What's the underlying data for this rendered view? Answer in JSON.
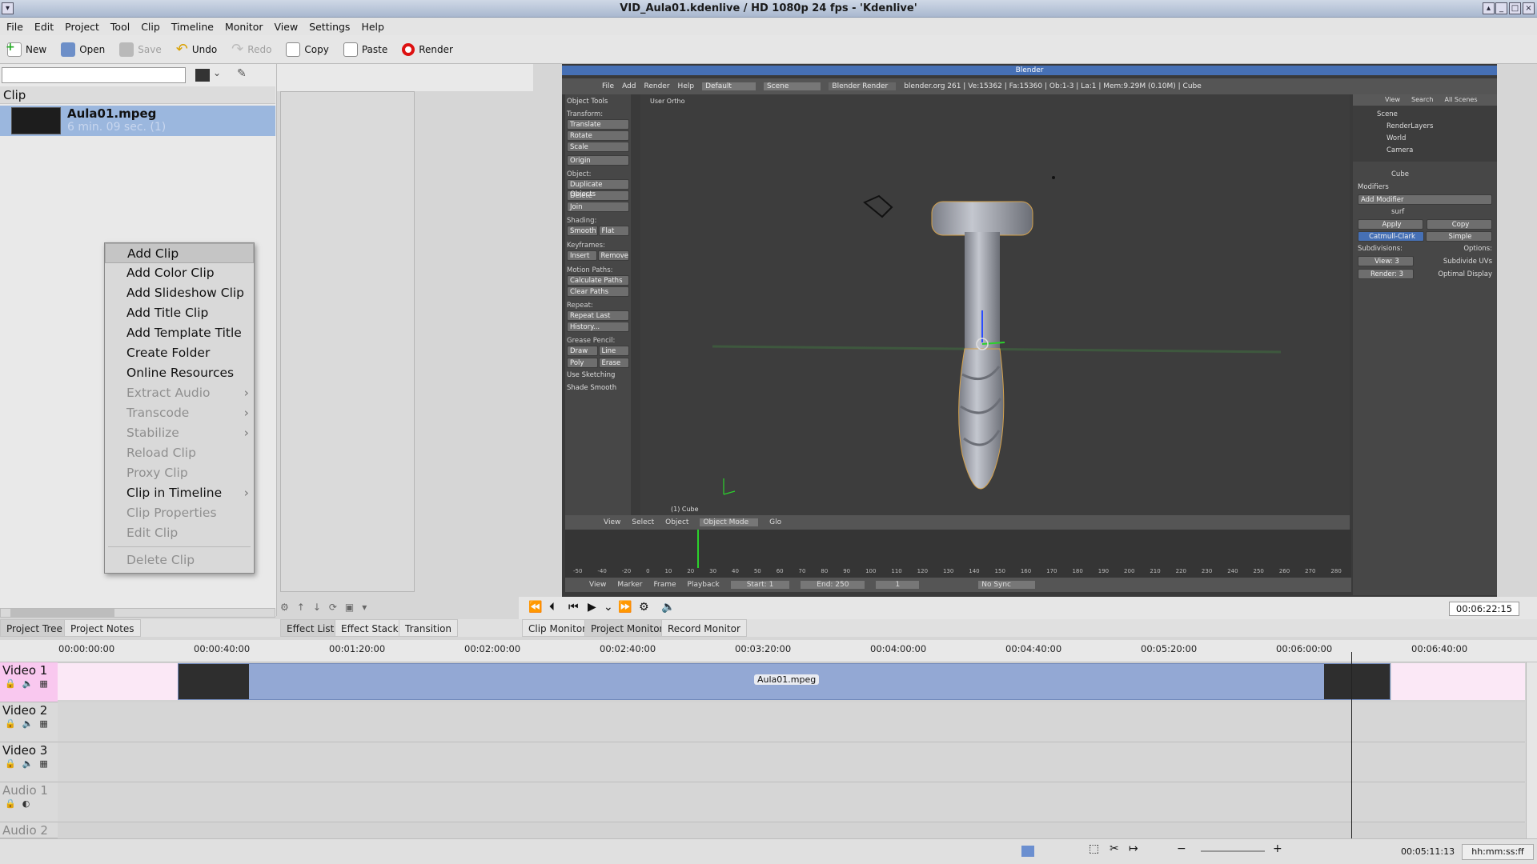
{
  "window": {
    "title": "VID_Aula01.kdenlive / HD 1080p 24 fps - 'Kdenlive'"
  },
  "menu": [
    "File",
    "Edit",
    "Project",
    "Tool",
    "Clip",
    "Timeline",
    "Monitor",
    "View",
    "Settings",
    "Help"
  ],
  "toolbar": {
    "new": "New",
    "open": "Open",
    "save": "Save",
    "undo": "Undo",
    "redo": "Redo",
    "copy": "Copy",
    "paste": "Paste",
    "render": "Render"
  },
  "bin": {
    "header": "Clip",
    "clip_name": "Aula01.mpeg",
    "clip_duration": "6 min. 09 sec. (1)"
  },
  "context_menu": {
    "items": [
      {
        "label": "Add Clip"
      },
      {
        "label": "Add Color Clip"
      },
      {
        "label": "Add Slideshow Clip"
      },
      {
        "label": "Add Title Clip"
      },
      {
        "label": "Add Template Title"
      },
      {
        "label": "Create Folder"
      },
      {
        "label": "Online Resources"
      },
      {
        "label": "Extract Audio"
      },
      {
        "label": "Transcode"
      },
      {
        "label": "Stabilize"
      },
      {
        "label": "Reload Clip"
      },
      {
        "label": "Proxy Clip"
      },
      {
        "label": "Clip in Timeline"
      },
      {
        "label": "Clip Properties"
      },
      {
        "label": "Edit Clip"
      },
      {
        "label": "Delete Clip"
      }
    ]
  },
  "blender": {
    "title": "Blender",
    "menu": [
      "File",
      "Add",
      "Render",
      "Help"
    ],
    "layout": "Default",
    "scene": "Scene",
    "engine": "Blender Render",
    "stats": "blender.org 261 | Ve:15362 | Fa:15360 | Ob:1-3 | La:1 | Mem:9.29M (0.10M) | Cube",
    "view_label": "User Ortho",
    "object_label": "(1) Cube",
    "tools": {
      "header": "Object Tools",
      "transform": "Transform:",
      "translate": "Translate",
      "rotate": "Rotate",
      "scale": "Scale",
      "origin": "Origin",
      "object": "Object:",
      "duplicate": "Duplicate Objects",
      "delete": "Delete",
      "join": "Join",
      "shading": "Shading:",
      "smooth": "Smooth",
      "flat": "Flat",
      "keyframes": "Keyframes:",
      "insert": "Insert",
      "remove": "Remove",
      "motion": "Motion Paths:",
      "calc": "Calculate Paths",
      "clear": "Clear Paths",
      "repeat": "Repeat:",
      "repeat_last": "Repeat Last",
      "history": "History...",
      "grease": "Grease Pencil:",
      "draw": "Draw",
      "line": "Line",
      "poly": "Poly",
      "erase": "Erase",
      "use_sketching": "Use Sketching",
      "shade_smooth": "Shade Smooth"
    },
    "outliner": {
      "view": "View",
      "search": "Search",
      "all_scenes": "All Scenes",
      "scene": "Scene",
      "render_layers": "RenderLayers",
      "world": "World",
      "camera": "Camera"
    },
    "properties": {
      "object": "Cube",
      "modifiers": "Modifiers",
      "add_modifier": "Add Modifier",
      "mod_name": "surf",
      "apply": "Apply",
      "copy": "Copy",
      "catmull": "Catmull-Clark",
      "simple": "Simple",
      "subdivisions": "Subdivisions:",
      "options": "Options:",
      "view": "View: 3",
      "render": "Render: 3",
      "subdiv_uvs": "Subdivide UVs",
      "optimal": "Optimal Display"
    },
    "footer3d": {
      "view": "View",
      "select": "Select",
      "object": "Object",
      "mode": "Object Mode",
      "glo": "Glo"
    },
    "timeline_footer": {
      "view": "View",
      "marker": "Marker",
      "frame": "Frame",
      "playback": "Playback",
      "start": "Start: 1",
      "end": "End: 250",
      "current": "1",
      "sync": "No Sync"
    },
    "ticks": [
      "-50",
      "-40",
      "-20",
      "0",
      "10",
      "20",
      "30",
      "40",
      "50",
      "60",
      "70",
      "80",
      "90",
      "100",
      "110",
      "120",
      "130",
      "140",
      "150",
      "160",
      "170",
      "180",
      "190",
      "200",
      "210",
      "220",
      "230",
      "240",
      "250",
      "260",
      "270",
      "280"
    ]
  },
  "monitor": {
    "timecode": "00:06:22:15"
  },
  "tabs": {
    "project_tree": "Project Tree",
    "project_notes": "Project Notes",
    "effect_list": "Effect List",
    "effect_stack": "Effect Stack",
    "transition": "Transition",
    "clip_monitor": "Clip Monitor",
    "project_monitor": "Project Monitor",
    "record_monitor": "Record Monitor"
  },
  "timeline": {
    "ruler": [
      "00:00:00:00",
      "00:00:40:00",
      "00:01:20:00",
      "00:02:00:00",
      "00:02:40:00",
      "00:03:20:00",
      "00:04:00:00",
      "00:04:40:00",
      "00:05:20:00",
      "00:06:00:00",
      "00:06:40:00"
    ],
    "tracks": [
      "Video 1",
      "Video 2",
      "Video 3",
      "Audio 1",
      "Audio 2"
    ],
    "clip_label": "Aula01.mpeg"
  },
  "status": {
    "position": "00:05:11:13",
    "format": "hh:mm:ss:ff"
  },
  "colors": {
    "selection": "#9bb7de",
    "clip": "#93a8d4",
    "pink": "#fbe8f6",
    "blender_accent": "#4670b5"
  }
}
